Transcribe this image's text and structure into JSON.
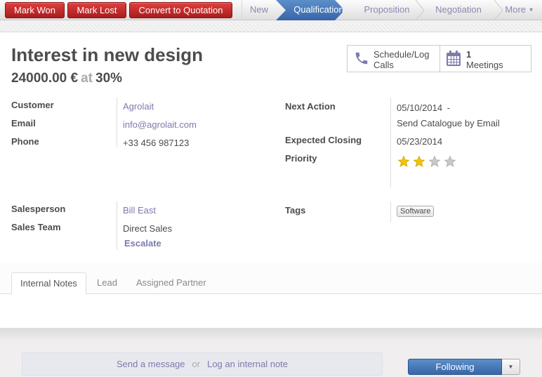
{
  "header": {
    "buttons": {
      "mark_won": "Mark Won",
      "mark_lost": "Mark Lost",
      "convert": "Convert to Quotation"
    },
    "stages": [
      {
        "label": "New",
        "active": false
      },
      {
        "label": "Qualification",
        "active": true
      },
      {
        "label": "Proposition",
        "active": false
      },
      {
        "label": "Negotiation",
        "active": false
      }
    ],
    "more_label": "More",
    "more_icon": "caret-down-icon"
  },
  "record": {
    "title": "Interest in new design",
    "revenue": "24000.00 €",
    "at_label": "at",
    "probability": "30",
    "percent_sign": "%"
  },
  "smart_buttons": {
    "calls": {
      "icon": "phone-icon",
      "label": "Schedule/Log Calls"
    },
    "meetings": {
      "icon": "calendar-icon",
      "count": "1",
      "label": "Meetings"
    }
  },
  "fields": {
    "customer": {
      "label": "Customer",
      "value": "Agrolait"
    },
    "email": {
      "label": "Email",
      "value": "info@agrolait.com"
    },
    "phone": {
      "label": "Phone",
      "value": "+33 456 987123"
    },
    "next_action": {
      "label": "Next Action",
      "date": "05/10/2014",
      "dash": "-",
      "text": "Send Catalogue by Email"
    },
    "expected_closing": {
      "label": "Expected Closing",
      "value": "05/23/2014"
    },
    "priority": {
      "label": "Priority",
      "stars_filled": 2,
      "stars_total": 4
    },
    "salesperson": {
      "label": "Salesperson",
      "value": "Bill East"
    },
    "sales_team": {
      "label": "Sales Team",
      "value": "Direct Sales",
      "escalate": "Escalate"
    },
    "tags": {
      "label": "Tags",
      "values": [
        "Software"
      ]
    }
  },
  "tabs": [
    {
      "label": "Internal Notes",
      "active": true
    },
    {
      "label": "Lead",
      "active": false
    },
    {
      "label": "Assigned Partner",
      "active": false
    }
  ],
  "chatter": {
    "send_message": "Send a message",
    "or": "or",
    "log_note": "Log an internal note",
    "following": "Following",
    "following_caret": "▼"
  },
  "colors": {
    "danger": "#c42a2a",
    "primary": "#4779b8",
    "link": "#7c7bad",
    "star_on": "#f5c400",
    "star_off": "#c8c8c8"
  }
}
